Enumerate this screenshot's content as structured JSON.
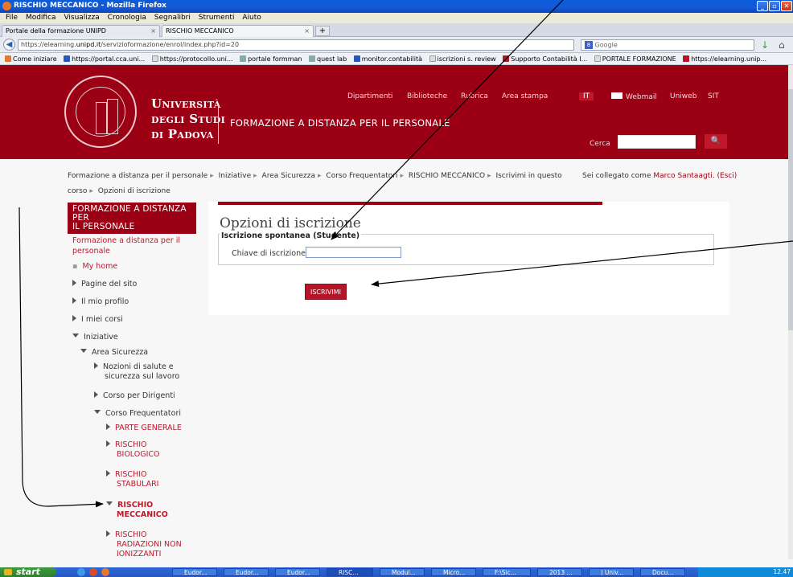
{
  "window": {
    "title": "RISCHIO MECCANICO - Mozilla Firefox"
  },
  "menu": [
    "File",
    "Modifica",
    "Visualizza",
    "Cronologia",
    "Segnalibri",
    "Strumenti",
    "Aiuto"
  ],
  "tabs": [
    {
      "label": "Portale della formazione UNIPD"
    },
    {
      "label": "RISCHIO MECCANICO"
    }
  ],
  "tab_new": "+",
  "url": {
    "prefix": "https://elearning.",
    "host": "unipd.it",
    "path": "/servizioformazione/enrol/index.php?id=20"
  },
  "browser_search": {
    "placeholder": "Google"
  },
  "bookmarks": [
    "Come iniziare",
    "https://portal.cca.uni...",
    "https://protocollo.uni...",
    "portale formman",
    "quest lab",
    "monitor.contabilità",
    "iscrizioni s. review",
    "Supporto Contabilità I...",
    "PORTALE FORMAZIONE",
    "https://elearning.unip..."
  ],
  "header": {
    "uni_line1": "Università",
    "uni_line2": "degli Studi",
    "uni_line3": "di Padova",
    "site_title": "FORMAZIONE A DISTANZA PER IL PERSONALE",
    "nav": [
      "Dipartimenti",
      "Biblioteche",
      "Rubrica",
      "Area stampa",
      "IT",
      "Webmail",
      "Uniweb",
      "SIT"
    ],
    "search_label": "Cerca",
    "search_btn": "🔍"
  },
  "breadcrumb": [
    "Formazione a distanza per il personale",
    "Iniziative",
    "Area Sicurezza",
    "Corso Frequentatori",
    "RISCHIO MECCANICO",
    "Iscrivimi in questo corso",
    "Opzioni di iscrizione"
  ],
  "login": {
    "prefix": "Sei collegato come",
    "user": "Marco Santaagti.",
    "logout": "(Esci)"
  },
  "block": {
    "title_line1": "FORMAZIONE A DISTANZA PER",
    "title_line2": "IL PERSONALE",
    "root_line1": "Formazione a distanza per il",
    "root_line2": "personale",
    "items": {
      "my_home": "My home",
      "pagine": "Pagine del sito",
      "profilo": "Il mio profilo",
      "corsi": "I miei corsi",
      "iniziative": "Iniziative",
      "area": "Area Sicurezza",
      "nozioni1": "Nozioni di salute e",
      "nozioni2": "sicurezza sul lavoro",
      "dirigenti": "Corso per Dirigenti",
      "frequentatori": "Corso Frequentatori",
      "generale": "PARTE GENERALE",
      "bio1": "RISCHIO",
      "bio2": "BIOLOGICO",
      "stab1": "RISCHIO",
      "stab2": "STABULARI",
      "mecc1": "RISCHIO",
      "mecc2": "MECCANICO",
      "rad1": "RISCHIO",
      "rad2": "RADIAZIONI NON",
      "rad3": "IONIZZANTI"
    }
  },
  "main": {
    "heading": "Opzioni di iscrizione",
    "legend": "Iscrizione spontanea (Studente)",
    "key_label": "Chiave di iscrizione",
    "key_value": "",
    "enrol_button": "ISCRIVIMI"
  },
  "taskbar": {
    "start": "start",
    "items": [
      "Eudor...",
      "Eudor...",
      "Eudor...",
      "RISC...",
      "Modul...",
      "Micro...",
      "F:\\Sic...",
      "2013 ...",
      "| Univ...",
      "Docu..."
    ],
    "clock": "12.47"
  },
  "colors": {
    "brand": "#9b0014",
    "accent": "#c0182b"
  }
}
